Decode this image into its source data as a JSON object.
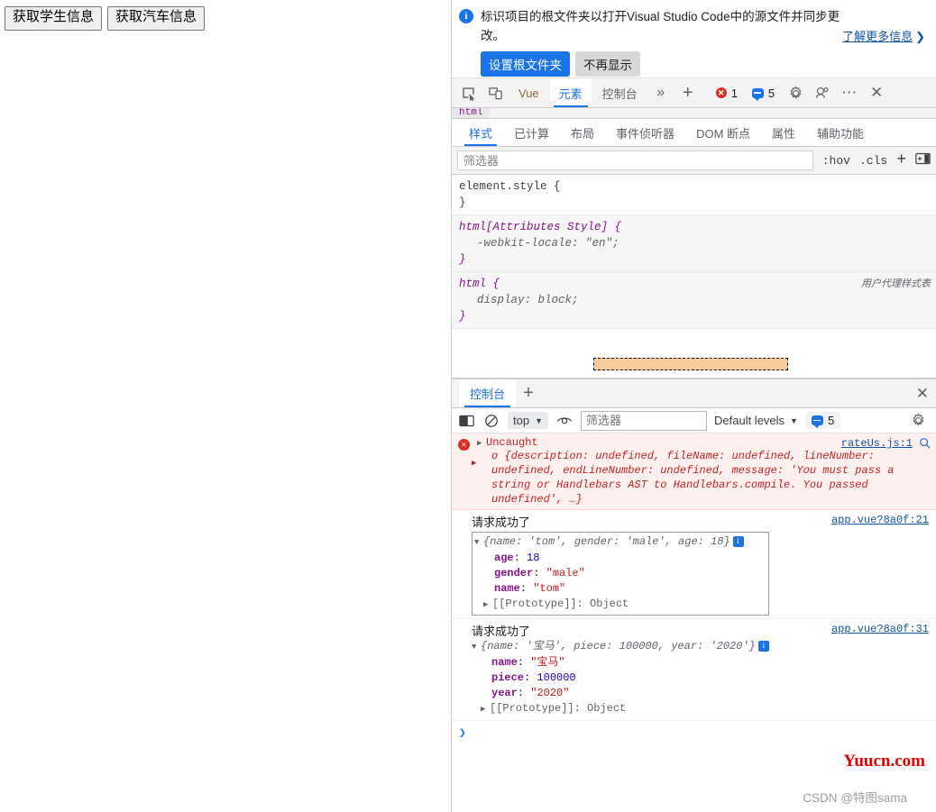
{
  "page": {
    "buttons": [
      {
        "label": "获取学生信息",
        "name": "get-student-info-button"
      },
      {
        "label": "获取汽车信息",
        "name": "get-car-info-button"
      }
    ]
  },
  "devtools": {
    "info_banner": {
      "icon": "info-icon",
      "message": "标识项目的根文件夹以打开Visual Studio Code中的源文件并同步更改。",
      "learn_more": "了解更多信息",
      "learn_more_chevron": "❯",
      "primary_button": "设置根文件夹",
      "secondary_button": "不再显示"
    },
    "main_toolbar": {
      "inspect_icon": "inspect-element-icon",
      "device_icon": "device-toolbar-icon",
      "tabs": [
        {
          "label": "Vue",
          "active": false
        },
        {
          "label": "元素",
          "active": true
        },
        {
          "label": "控制台",
          "active": false
        }
      ],
      "more_tabs_icon": "chevron-double-right-icon",
      "add_tab_icon": "plus-icon",
      "error_badge": "1",
      "message_badge": "5",
      "settings_icon": "gear-icon",
      "customize_icon": "devices-icon",
      "more_icon": "more-options-icon",
      "close_icon": "close-icon"
    },
    "breadcrumb": "html",
    "styles_tabs": [
      {
        "label": "样式",
        "active": true
      },
      {
        "label": "已计算",
        "active": false
      },
      {
        "label": "布局",
        "active": false
      },
      {
        "label": "事件侦听器",
        "active": false
      },
      {
        "label": "DOM 断点",
        "active": false
      },
      {
        "label": "属性",
        "active": false
      },
      {
        "label": "辅助功能",
        "active": false
      }
    ],
    "style_filter": {
      "placeholder": "筛选器",
      "value": "",
      "hov": ":hov",
      "cls": ".cls",
      "new_rule_icon": "plus-icon",
      "layout_icon": "computed-sidebar-icon"
    },
    "rules": [
      {
        "selector": "element.style {",
        "properties": [],
        "close": "}",
        "origin": "",
        "ua": false
      },
      {
        "selector": "html[Attributes Style] {",
        "properties": [
          "-webkit-locale: \"en\";"
        ],
        "close": "}",
        "origin": "",
        "ua": true
      },
      {
        "selector": "html {",
        "properties": [
          "display: block;"
        ],
        "close": "}",
        "origin": "用户代理样式表",
        "ua": true
      }
    ],
    "box_model": {
      "element_color": "#f8cb9c"
    },
    "drawer": {
      "tab_label": "控制台",
      "add_icon": "plus-icon",
      "close_icon": "close-icon",
      "toolbar": {
        "sidebar_icon": "console-sidebar-icon",
        "clear_icon": "clear-console-icon",
        "context": "top",
        "context_caret": "▼",
        "eye_icon": "live-expression-icon",
        "filter_placeholder": "筛选器",
        "filter_value": "",
        "levels_label": "Default levels",
        "levels_caret": "▼",
        "message_badge": "5",
        "settings_icon": "gear-icon"
      },
      "messages": [
        {
          "type": "error",
          "icon": "error-icon",
          "head": "Uncaught",
          "body": "o {description: undefined, fileName: undefined, lineNumber: undefined, endLineNumber: undefined, message: 'You must pass a string or Handlebars AST to Handlebars.compile. You passed undefined', …}",
          "source": "rateUs.js:1",
          "lens_icon": "search-in-sources-icon"
        },
        {
          "type": "log",
          "title": "请求成功了",
          "source": "app.vue?8a0f:21",
          "preview": "{name: 'tom', gender: 'male', age: 18}",
          "props": [
            {
              "key": "age",
              "value": "18",
              "kind": "num"
            },
            {
              "key": "gender",
              "value": "\"male\"",
              "kind": "str"
            },
            {
              "key": "name",
              "value": "\"tom\"",
              "kind": "str"
            }
          ],
          "prototype": "[[Prototype]]: Object"
        },
        {
          "type": "log",
          "title": "请求成功了",
          "source": "app.vue?8a0f:31",
          "preview": "{name: '宝马', piece: 100000, year: '2020'}",
          "props": [
            {
              "key": "name",
              "value": "\"宝马\"",
              "kind": "str"
            },
            {
              "key": "piece",
              "value": "100000",
              "kind": "num"
            },
            {
              "key": "year",
              "value": "\"2020\"",
              "kind": "str"
            }
          ],
          "prototype": "[[Prototype]]: Object"
        }
      ],
      "prompt": "❯"
    }
  },
  "watermarks": {
    "site": "Yuucn.com",
    "author": "CSDN @特图sama"
  }
}
